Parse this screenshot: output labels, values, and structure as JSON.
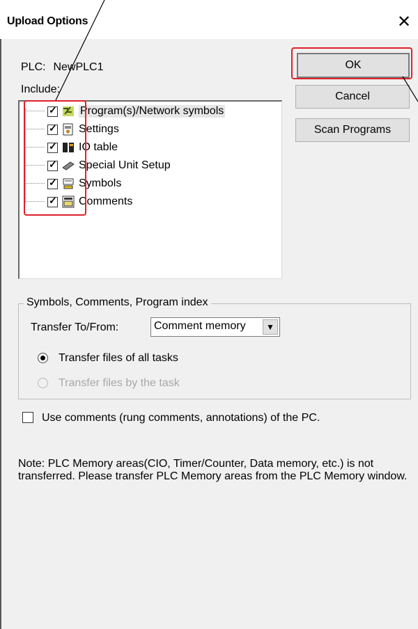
{
  "window": {
    "title": "Upload Options",
    "close_glyph": "✕"
  },
  "plc": {
    "label": "PLC:",
    "name": "NewPLC1"
  },
  "include": {
    "label": "Include:",
    "items": [
      {
        "label": "Program(s)/Network symbols",
        "checked": true,
        "icon": "program-icon",
        "selected": true
      },
      {
        "label": "Settings",
        "checked": true,
        "icon": "settings-icon"
      },
      {
        "label": "IO table",
        "checked": true,
        "icon": "io-table-icon"
      },
      {
        "label": "Special Unit Setup",
        "checked": true,
        "icon": "special-unit-icon"
      },
      {
        "label": "Symbols",
        "checked": true,
        "icon": "symbols-icon"
      },
      {
        "label": "Comments",
        "checked": true,
        "icon": "comments-icon"
      }
    ]
  },
  "buttons": {
    "ok": "OK",
    "cancel": "Cancel",
    "scan": "Scan Programs"
  },
  "group": {
    "title": "Symbols, Comments, Program index",
    "transfer_label": "Transfer To/From:",
    "transfer_value": "Comment memory",
    "radio_all": "Transfer files of all tasks",
    "radio_task": "Transfer files by the task"
  },
  "use_comments": {
    "label": "Use comments (rung comments, annotations) of the PC.",
    "checked": false
  },
  "note": "Note: PLC Memory areas(CIO, Timer/Counter, Data memory, etc.) is not transferred. Please transfer PLC Memory areas from the PLC Memory window.",
  "colors": {
    "highlight_red": "#e0202a",
    "dialog_bg": "#f0f0f0"
  }
}
